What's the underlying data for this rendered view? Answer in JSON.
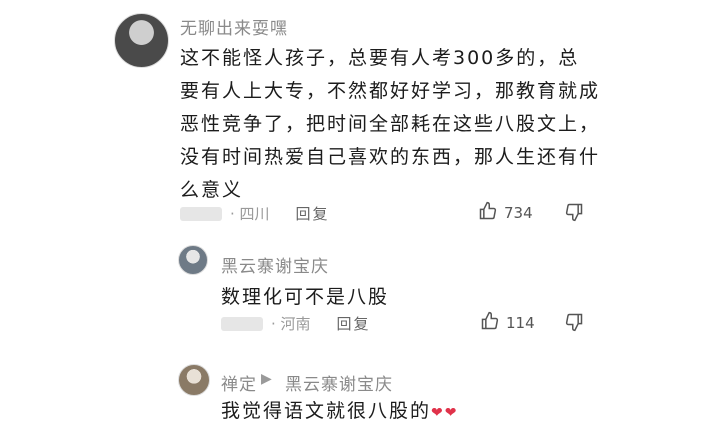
{
  "main_comment": {
    "username": "无聊出来耍嘿",
    "text": "这不能怪人孩子，总要有人考300多的，总要有人上大专，不然都好好学习，那教育就成恶性竞争了，把时间全部耗在这些八股文上，没有时间热爱自己喜欢的东西，那人生还有什么意义",
    "location": "· 四川",
    "reply_label": "回复",
    "likes": "734"
  },
  "reply_1": {
    "username": "黑云寨谢宝庆",
    "text": "数理化可不是八股",
    "location": "· 河南",
    "reply_label": "回复",
    "likes": "114"
  },
  "reply_2": {
    "username": "禅定",
    "reply_to": "黑云寨谢宝庆",
    "text": "我觉得语文就很八股的",
    "emoji": "❤❤"
  },
  "icons": {
    "like": "thumbs-up-icon",
    "dislike": "thumbs-down-icon",
    "reply_arrow": "play-triangle-icon"
  }
}
